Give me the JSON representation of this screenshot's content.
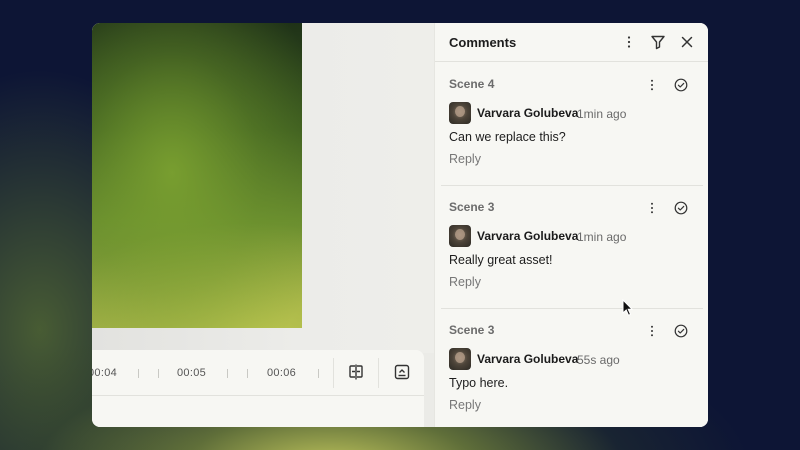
{
  "timeline": {
    "ruler": [
      "00:04",
      "00:05",
      "00:06"
    ],
    "tools": [
      {
        "icon": "split-clip-icon"
      },
      {
        "icon": "collapse-panel-icon"
      }
    ]
  },
  "comments_panel": {
    "title": "Comments",
    "header_icons": [
      "more-vertical-icon",
      "filter-icon",
      "close-icon"
    ],
    "comments": [
      {
        "scene": "Scene 4",
        "author": "Varvara Golubeva",
        "time": "1min ago",
        "text": "Can we replace this?",
        "reply_label": "Reply"
      },
      {
        "scene": "Scene 3",
        "author": "Varvara Golubeva",
        "time": "1min ago",
        "text": "Really great asset!",
        "reply_label": "Reply"
      },
      {
        "scene": "Scene 3",
        "author": "Varvara Golubeva",
        "time": "55s ago",
        "text": "Typo here.",
        "reply_label": "Reply"
      }
    ]
  }
}
